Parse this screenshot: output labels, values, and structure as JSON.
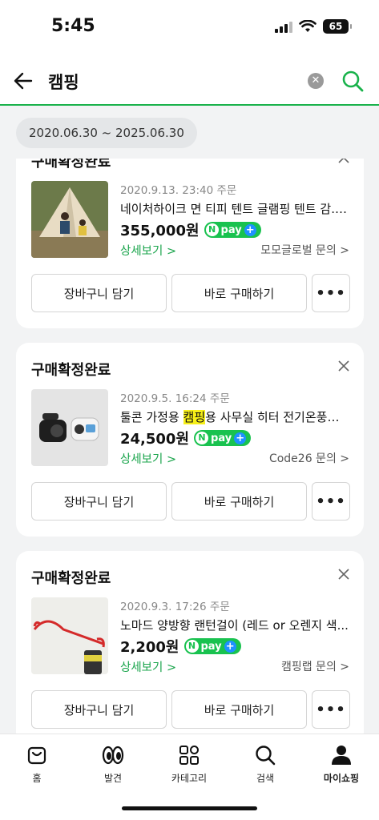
{
  "status": {
    "time": "5:45",
    "battery": "65"
  },
  "search": {
    "query": "캠핑"
  },
  "filter": {
    "date_range": "2020.06.30 ~ 2025.06.30"
  },
  "orders": [
    {
      "status": "구매확정완료",
      "date": "2020.9.13. 23:40 주문",
      "name": "네이처하이크 면 티피 텐트 글램핑 텐트 감...",
      "price": "355,000원",
      "detail": "상세보기 >",
      "seller": "모모글로벌 문의 >"
    },
    {
      "status": "구매확정완료",
      "date": "2020.9.5. 16:24 주문",
      "name_before": "툴콘 가정용 ",
      "name_highlight": "캠핑",
      "name_after": "용 사무실 히터 전기온풍기...",
      "price": "24,500원",
      "detail": "상세보기 >",
      "seller": "Code26 문의 >"
    },
    {
      "status": "구매확정완료",
      "date": "2020.9.3. 17:26 주문",
      "name": "노마드 양방향 랜턴걸이 (레드 or 오렌지 색...",
      "price": "2,200원",
      "detail": "상세보기 >",
      "seller": "캠핑랩 문의 >"
    }
  ],
  "buttons": {
    "cart": "장바구니 담기",
    "buy": "바로 구매하기",
    "more": "•••"
  },
  "npay": {
    "n": "N",
    "label": "pay",
    "plus": "+"
  },
  "tabs": [
    {
      "label": "홈",
      "icon": "home-bag-icon"
    },
    {
      "label": "발견",
      "icon": "eyes-icon"
    },
    {
      "label": "카테고리",
      "icon": "category-grid-icon"
    },
    {
      "label": "검색",
      "icon": "search-icon"
    },
    {
      "label": "마이쇼핑",
      "icon": "person-icon"
    }
  ],
  "colors": {
    "accent": "#19b24b",
    "npay": "#19c24f",
    "highlight": "#f7f018"
  }
}
